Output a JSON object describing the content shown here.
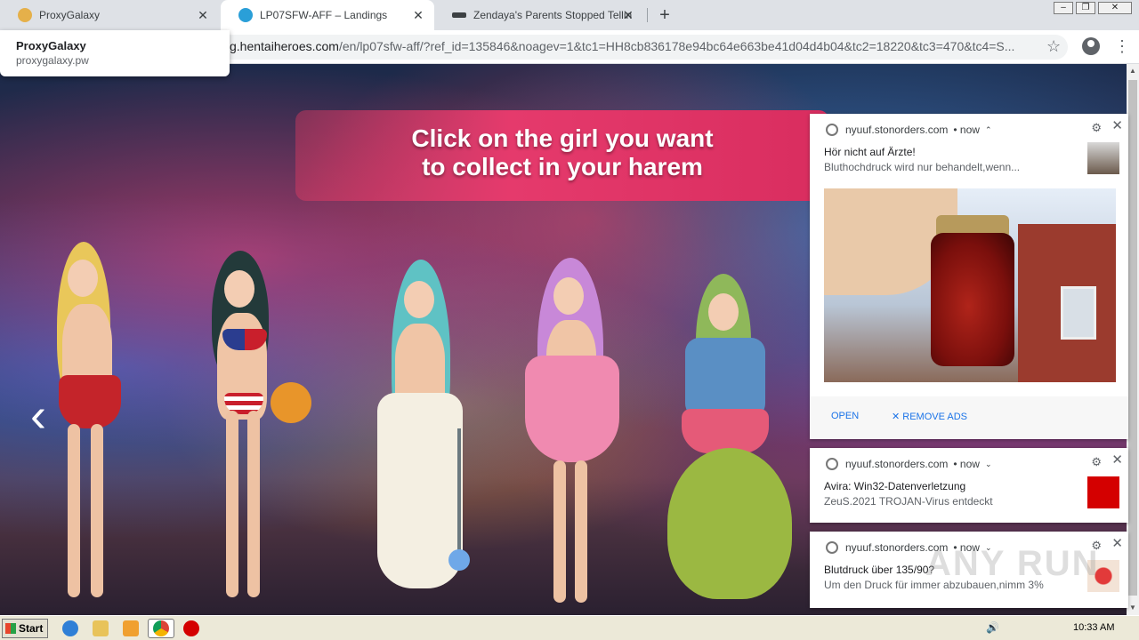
{
  "browser": {
    "tabs": [
      {
        "title": "ProxyGalaxy",
        "icon": "coin-favicon-icon",
        "active": false
      },
      {
        "title": "LP07SFW-AFF – Landings",
        "icon": "hh-favicon-icon",
        "active": true
      },
      {
        "title": "Zendaya's Parents Stopped Telling H",
        "icon": "key-favicon-icon",
        "active": false
      }
    ],
    "new_tab_label": "+",
    "url_host": "g.hentaiheroes.com",
    "url_rest": "/en/lp07sfw-aff/?ref_id=135846&noagev=1&tc1=HH8cb836178e94bc64e663be41d04d4b04&tc2=18220&tc3=470&tc4=S..."
  },
  "hovercard": {
    "title": "ProxyGalaxy",
    "url": "proxygalaxy.pw"
  },
  "page": {
    "banner_line1": "Click on the girl you want",
    "banner_line2": "to collect in your harem",
    "arrow_left": "‹"
  },
  "notifications": [
    {
      "source": "nyuuf.stonorders.com",
      "time": "• now",
      "title": "Hör nicht auf Ärzte!",
      "body": "Bluthochdruck wird nur behandelt,wenn...",
      "open_label": "OPEN",
      "remove_label": "REMOVE ADS"
    },
    {
      "source": "nyuuf.stonorders.com",
      "time": "• now",
      "title": "Avira: Win32-Datenverletzung",
      "body": "ZeuS.2021 TROJAN-Virus entdeckt"
    },
    {
      "source": "nyuuf.stonorders.com",
      "time": "• now",
      "title": "Blutdruck über 135/90?",
      "body": "Um den Druck für immer abzubauen,nimm 3%"
    }
  ],
  "taskbar": {
    "start_label": "Start",
    "clock": "10:33 AM"
  },
  "watermark": "ANY RUN",
  "colors": {
    "banner": "#e53a6c",
    "link_blue": "#1a73e8",
    "avira_red": "#d40000"
  }
}
